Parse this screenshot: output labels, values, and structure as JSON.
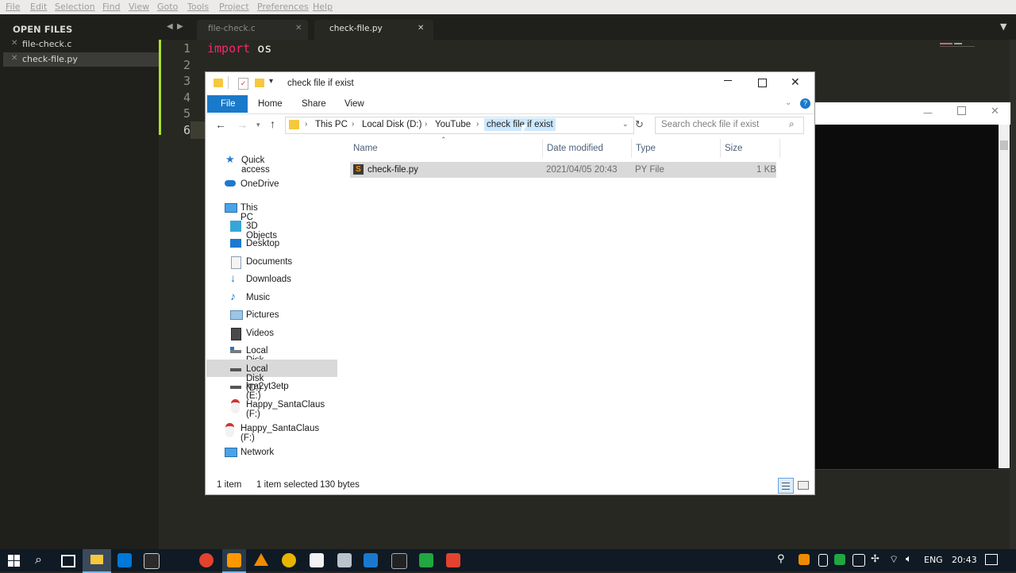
{
  "menu": [
    "File",
    "Edit",
    "Selection",
    "Find",
    "View",
    "Goto",
    "Tools",
    "Project",
    "Preferences",
    "Help"
  ],
  "sidebar": {
    "header": "OPEN FILES",
    "files": [
      "file-check.c",
      "check-file.py"
    ]
  },
  "tabs": [
    "file-check.c",
    "check-file.py"
  ],
  "code": {
    "line_numbers": [
      "1",
      "2",
      "3",
      "4",
      "5",
      "6"
    ],
    "keyword": "import",
    "module": "os"
  },
  "explorer": {
    "title": "check file if exist",
    "ribbon_tabs": [
      "File",
      "Home",
      "Share",
      "View"
    ],
    "breadcrumb": [
      "This PC",
      "Local Disk (D:)",
      "YouTube",
      "check file if exist"
    ],
    "search_placeholder": "Search check file if exist",
    "columns": [
      "Name",
      "Date modified",
      "Type",
      "Size"
    ],
    "file": {
      "name": "check-file.py",
      "date": "2021/04/05 20:43",
      "type": "PY File",
      "size": "1 KB"
    },
    "nav": {
      "quick_access": "Quick access",
      "onedrive": "OneDrive",
      "this_pc": "This PC",
      "pc_items": [
        "3D Objects",
        "Desktop",
        "Documents",
        "Downloads",
        "Music",
        "Pictures",
        "Videos",
        "Local Disk (C:)",
        "Local Disk (D:)",
        "kra2yt3etp (E:)",
        "Happy_SantaClaus (F:)"
      ],
      "drive_f": "Happy_SantaClaus (F:)",
      "network": "Network"
    },
    "status": {
      "items": "1 item",
      "selected": "1 item selected",
      "bytes": "130 bytes"
    }
  },
  "taskbar": {
    "language": "ENG",
    "time": "20:43"
  },
  "colors": {
    "accent": "#0063b1",
    "keyword": "#f92672",
    "selection": "#cce8ff",
    "gutter_mark": "#a6e22e"
  }
}
